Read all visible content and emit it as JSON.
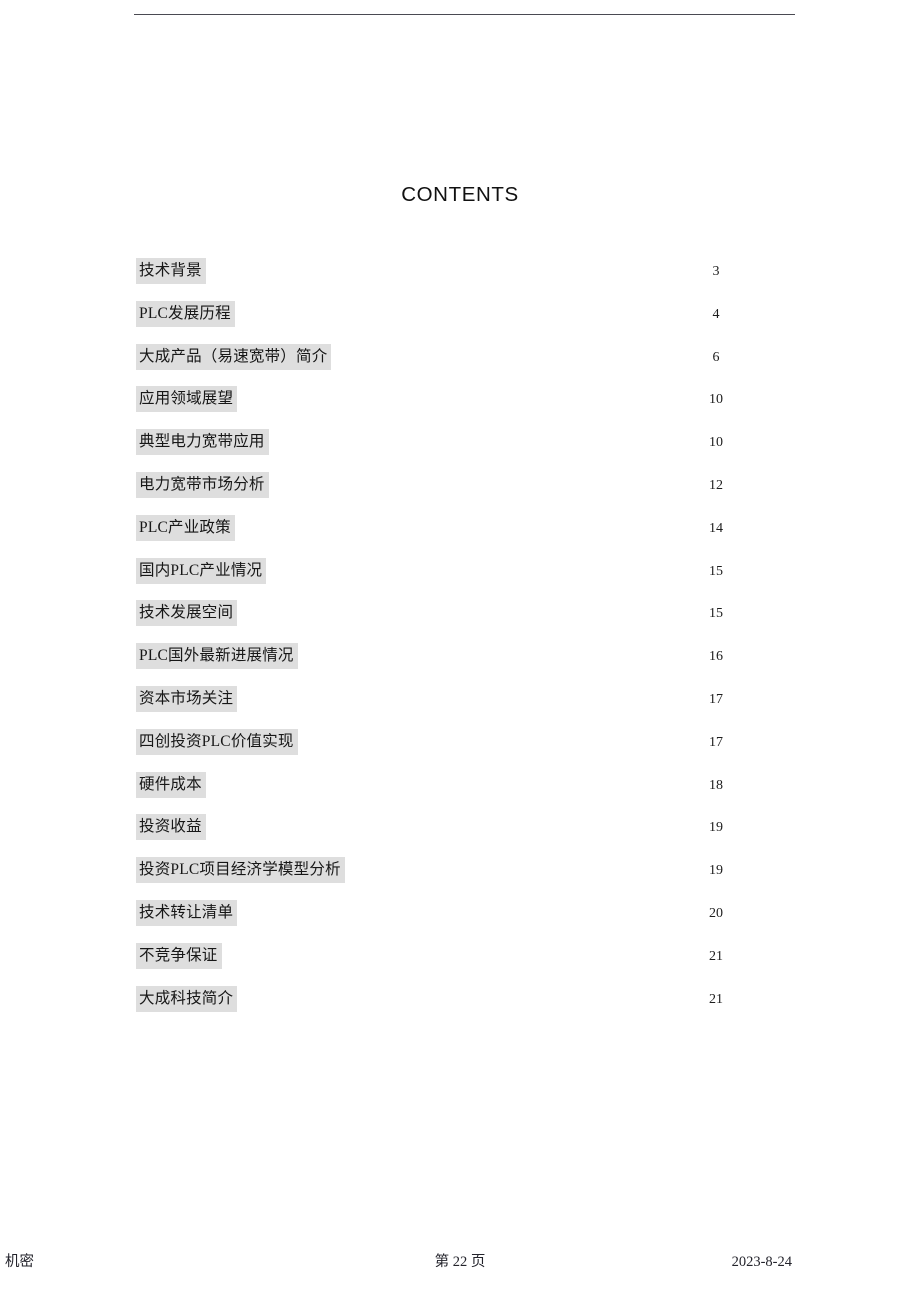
{
  "document": {
    "title": "CONTENTS"
  },
  "toc": {
    "entries": [
      {
        "label": "技术背景",
        "page": "3"
      },
      {
        "label": "PLC发展历程",
        "page": "4"
      },
      {
        "label": "大成产品（易速宽带）简介",
        "page": "6"
      },
      {
        "label": "应用领域展望",
        "page": "10"
      },
      {
        "label": "典型电力宽带应用",
        "page": "10"
      },
      {
        "label": "电力宽带市场分析",
        "page": "12"
      },
      {
        "label": "PLC产业政策",
        "page": "14"
      },
      {
        "label": "国内PLC产业情况",
        "page": "15"
      },
      {
        "label": "技术发展空间",
        "page": "15"
      },
      {
        "label": "PLC国外最新进展情况",
        "page": "16"
      },
      {
        "label": "资本市场关注",
        "page": "17"
      },
      {
        "label": "四创投资PLC价值实现",
        "page": "17"
      },
      {
        "label": "硬件成本",
        "page": "18"
      },
      {
        "label": "投资收益",
        "page": "19"
      },
      {
        "label": "投资PLC项目经济学模型分析",
        "page": "19"
      },
      {
        "label": "技术转让清单",
        "page": "20"
      },
      {
        "label": "不竞争保证",
        "page": "21"
      },
      {
        "label": "大成科技简介",
        "page": "21"
      }
    ]
  },
  "footer": {
    "classification": "机密",
    "page_indicator": "第 22 页",
    "date": "2023-8-24"
  },
  "colors": {
    "highlight": "#dedede",
    "rule": "#4a4a52",
    "text": "#1a1a1a"
  }
}
